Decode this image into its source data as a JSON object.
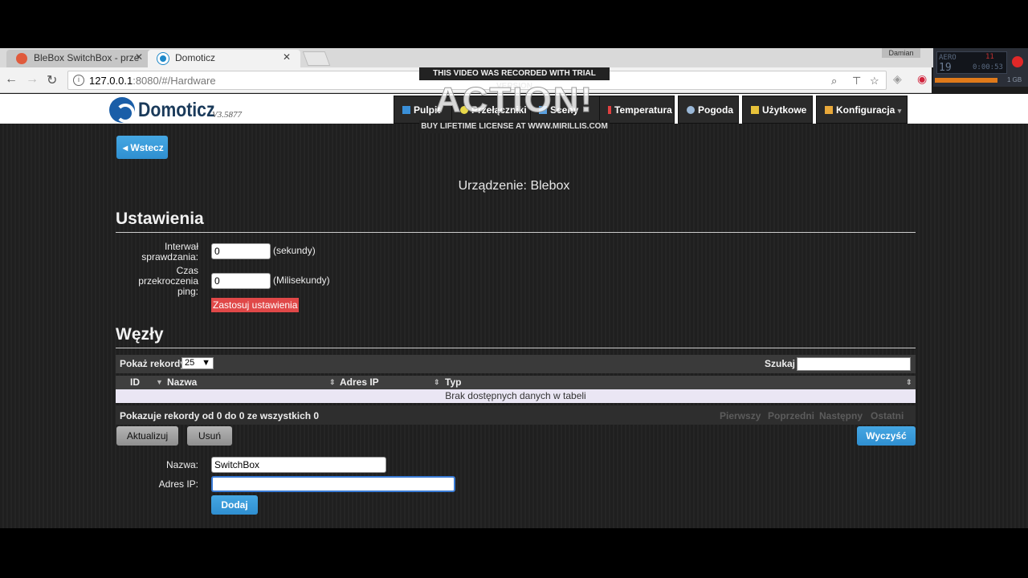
{
  "browser": {
    "tabs": [
      {
        "label": "BleBox SwitchBox - prze",
        "close": "✕"
      },
      {
        "label": "Domoticz",
        "close": "✕"
      }
    ],
    "profile_name": "Damian",
    "url_host": "127.0.0.1",
    "url_path": ":8080/#/Hardware"
  },
  "recorder": {
    "label": "AERO",
    "count": "19",
    "time": "0:00:53",
    "timer_small": "11",
    "storage": "1 GB"
  },
  "watermark": {
    "top": "THIS VIDEO WAS RECORDED WITH TRIAL VERSION",
    "logo": "ACTION!",
    "bottom": "BUY LIFETIME LICENSE AT WWW.MIRILLIS.COM"
  },
  "app": {
    "logo_text": "Domoticz",
    "version": "V3.5877",
    "nav": [
      "Pulpit",
      "Przełączniki",
      "Sceny",
      "Temperatura",
      "Pogoda",
      "Użytkowe",
      "Konfiguracja"
    ]
  },
  "page": {
    "back_label": "Wstecz",
    "device_title": "Urządzenie: Blebox",
    "settings_title": "Ustawienia",
    "interval_label_1": "Interwał",
    "interval_label_2": "sprawdzania:",
    "interval_value": "0",
    "interval_unit": "(sekundy)",
    "timeout_label_1": "Czas",
    "timeout_label_2": "przekroczenia",
    "timeout_label_3": "ping:",
    "timeout_value": "0",
    "timeout_unit": "(Milisekundy)",
    "apply_label": "Zastosuj ustawienia",
    "nodes_title": "Węzły",
    "show_records_label": "Pokaż rekordy",
    "page_size": "25",
    "search_label": "Szukaj :",
    "search_value": "",
    "columns": [
      "ID",
      "Nazwa",
      "Adres IP",
      "Typ"
    ],
    "empty_text": "Brak dostępnych danych w tabeli",
    "records_info": "Pokazuje rekordy od 0 do 0 ze wszystkich 0",
    "pager": [
      "Pierwszy",
      "Poprzedni",
      "Następny",
      "Ostatni"
    ],
    "update_label": "Aktualizuj",
    "delete_label": "Usuń",
    "clear_label": "Wyczyść",
    "name_label": "Nazwa:",
    "name_value": "SwitchBox",
    "ip_label": "Adres IP:",
    "ip_value": "",
    "add_label": "Dodaj"
  }
}
